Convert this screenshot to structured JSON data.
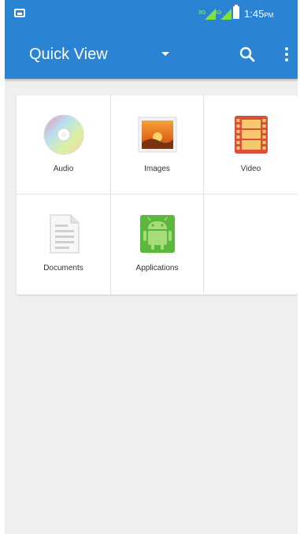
{
  "status_bar": {
    "time": "1:45",
    "time_suffix": "PM",
    "accent_color": "#2b83d3",
    "signal_color": "#7fe23a"
  },
  "app_bar": {
    "title": "Quick View",
    "icons": [
      "dropdown-arrow-icon",
      "search-icon",
      "overflow-menu-icon"
    ]
  },
  "categories": [
    {
      "label": "Audio",
      "icon": "audio-disc-icon"
    },
    {
      "label": "Images",
      "icon": "images-icon"
    },
    {
      "label": "Video",
      "icon": "video-film-icon"
    },
    {
      "label": "Documents",
      "icon": "document-icon"
    },
    {
      "label": "Applications",
      "icon": "android-app-icon"
    }
  ]
}
